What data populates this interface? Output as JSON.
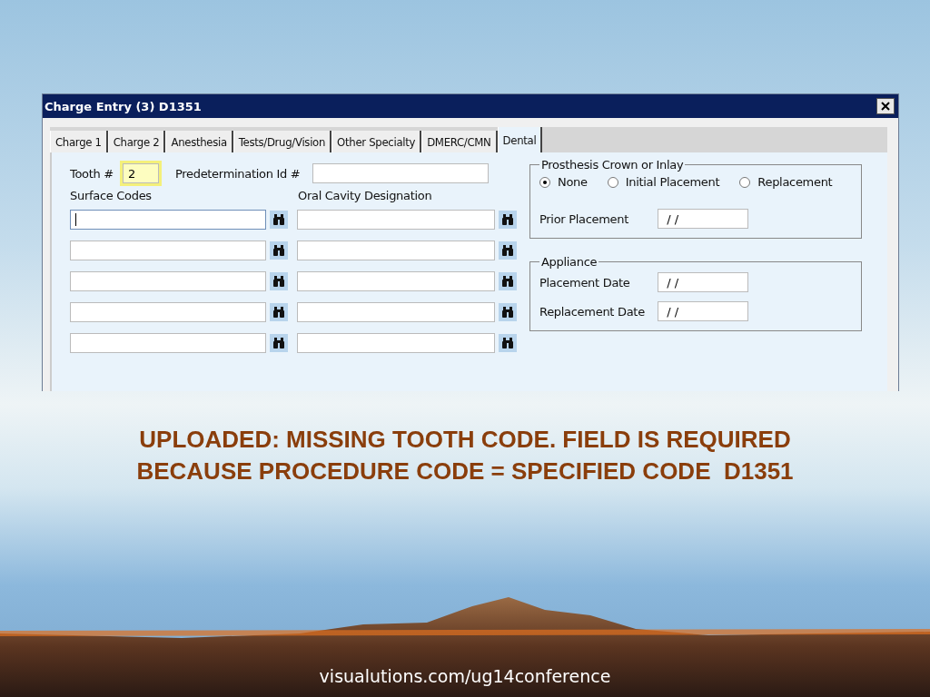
{
  "window": {
    "title": "Charge Entry (3) D1351"
  },
  "tabs": [
    {
      "label": "Charge 1",
      "selected": false
    },
    {
      "label": "Charge 2",
      "selected": false
    },
    {
      "label": "Anesthesia",
      "selected": false
    },
    {
      "label": "Tests/Drug/Vision",
      "selected": false
    },
    {
      "label": "Other Specialty",
      "selected": false
    },
    {
      "label": "DMERC/CMN",
      "selected": false
    },
    {
      "label": "Dental",
      "selected": true
    }
  ],
  "tooth": {
    "label": "Tooth #",
    "value": "2",
    "highlighted": true
  },
  "predetermination": {
    "label": "Predetermination Id #"
  },
  "surface_codes": {
    "label": "Surface Codes",
    "rows": [
      {
        "focused": true
      },
      {
        "focused": false
      },
      {
        "focused": false
      },
      {
        "focused": false
      },
      {
        "focused": false
      }
    ]
  },
  "oral_cavity": {
    "label": "Oral Cavity Designation",
    "rows": [
      {
        "focused": false
      },
      {
        "focused": false
      },
      {
        "focused": false
      },
      {
        "focused": false
      },
      {
        "focused": false
      }
    ]
  },
  "prosthesis": {
    "title": "Prosthesis Crown or Inlay",
    "options": [
      {
        "label": "None",
        "selected": true
      },
      {
        "label": "Initial Placement",
        "selected": false
      },
      {
        "label": "Replacement",
        "selected": false
      }
    ],
    "prior_placement": {
      "label": "Prior Placement",
      "value": " / /"
    }
  },
  "appliance": {
    "title": "Appliance",
    "fields": [
      {
        "label": "Placement Date",
        "value": " / /"
      },
      {
        "label": "Replacement Date",
        "value": " / /"
      }
    ]
  },
  "caption": [
    "UPLOADED: MISSING TOOTH CODE. FIELD IS REQUIRED",
    "BECAUSE PROCEDURE CODE = SPECIFIED CODE  D1351"
  ],
  "footer": "visualutions.com/ug14conference"
}
